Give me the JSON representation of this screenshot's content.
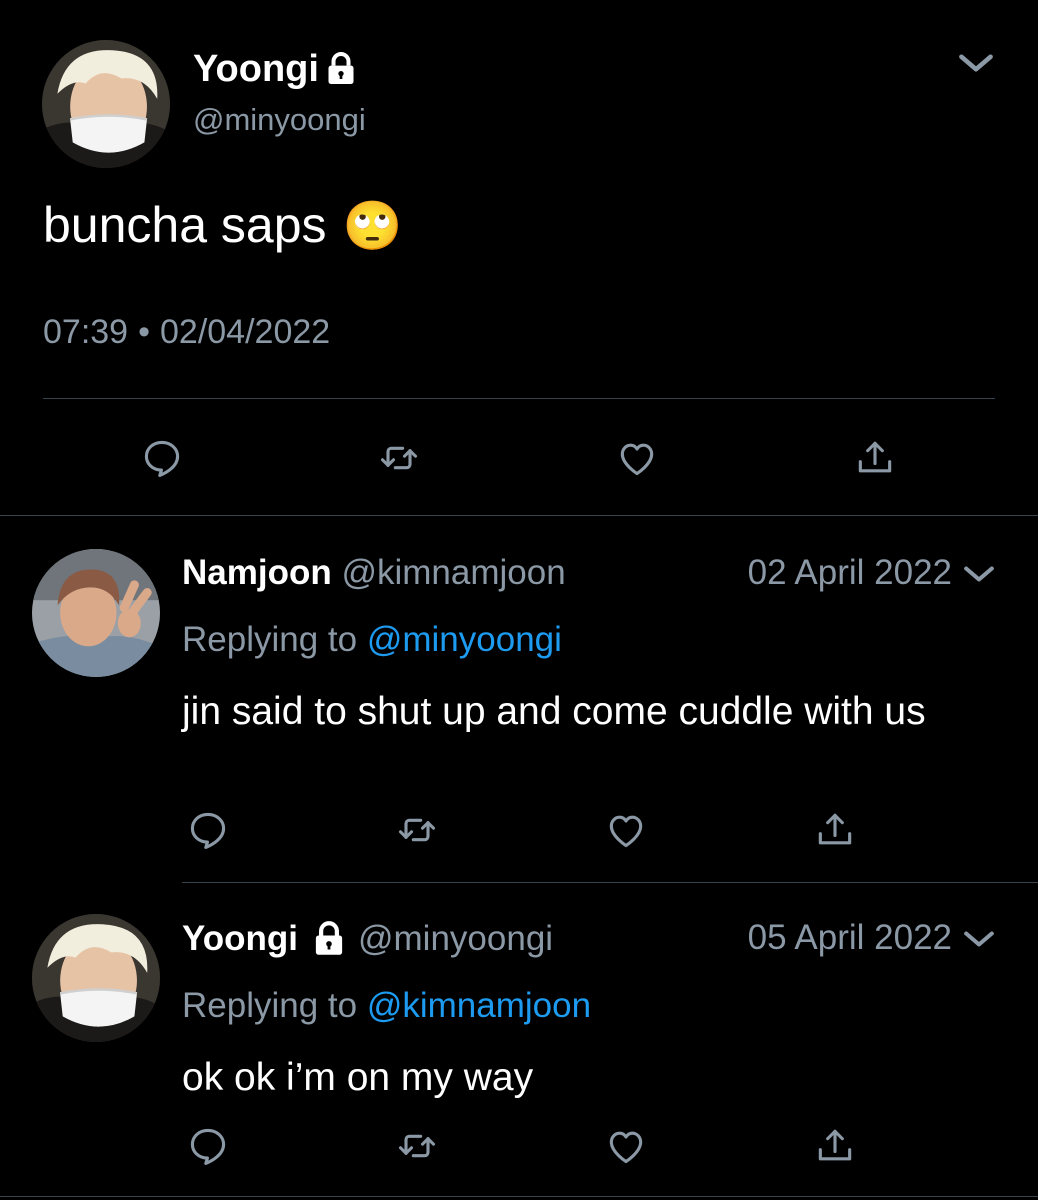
{
  "main_tweet": {
    "display_name": "Yoongi",
    "handle": "@minyoongi",
    "text": "buncha saps",
    "emoji": "🙄",
    "time": "07:39",
    "separator": "•",
    "date": "02/04/2022"
  },
  "replies": [
    {
      "display_name": "Namjoon",
      "handle": "@kimnamjoon",
      "date": "02 April 2022",
      "replying_prefix": "Replying to",
      "replying_to": "@minyoongi",
      "text": "jin said to shut up and come cuddle with us"
    },
    {
      "display_name": "Yoongi",
      "handle": "@minyoongi",
      "date": "05 April 2022",
      "replying_prefix": "Replying to",
      "replying_to": "@kimnamjoon",
      "text": "ok ok i’m on my way"
    }
  ],
  "colors": {
    "background": "#000000",
    "text": "#ffffff",
    "muted": "#8b98a5",
    "link": "#1d9bf0",
    "divider": "#38444d"
  },
  "icons": [
    "lock-icon",
    "chevron-down-icon",
    "reply-icon",
    "retweet-icon",
    "like-icon",
    "share-icon"
  ]
}
